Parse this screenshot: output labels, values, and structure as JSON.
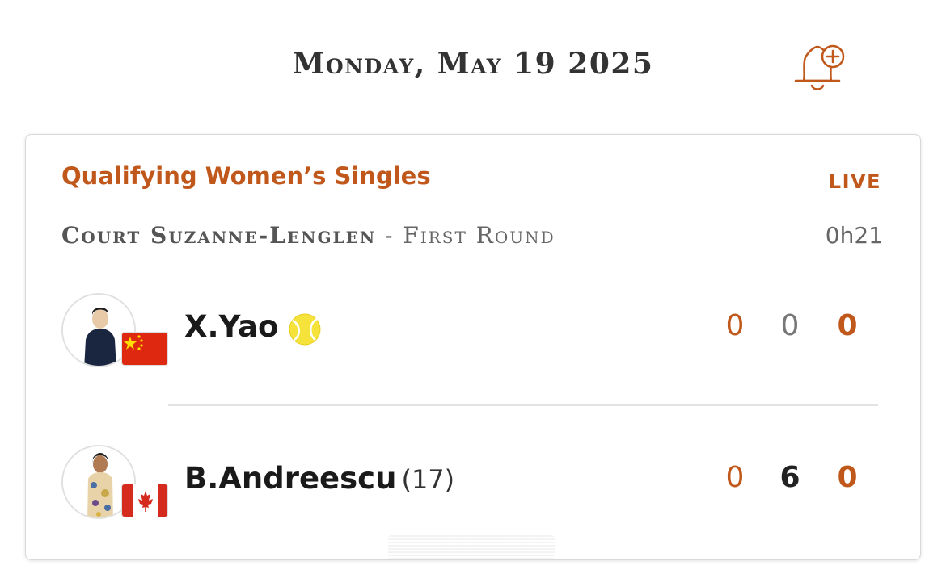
{
  "header": {
    "date": "Monday, May 19 2025",
    "bell_icon": "bell-plus-icon"
  },
  "match": {
    "event": "Qualifying Women’s Singles",
    "status": "LIVE",
    "court": "Court Suzanne-Lenglen",
    "separator": " - ",
    "round": "First Round",
    "duration": "0h21",
    "players": [
      {
        "name": "X.Yao",
        "seed": "",
        "country_flag": "china-flag",
        "serving": true,
        "scores": [
          "0",
          "0",
          "0"
        ]
      },
      {
        "name": "B.Andreescu",
        "seed": "(17)",
        "country_flag": "canada-flag",
        "serving": false,
        "scores": [
          "0",
          "6",
          "0"
        ]
      }
    ]
  },
  "colors": {
    "accent": "#c1581b",
    "ball": "#f5e23a"
  }
}
